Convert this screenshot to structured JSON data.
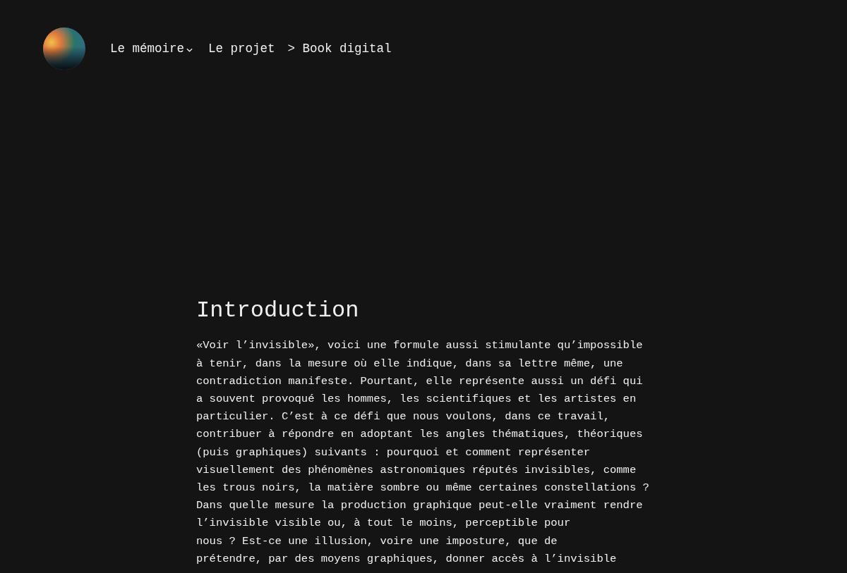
{
  "nav": {
    "items": [
      {
        "label": "Le mémoire",
        "kind": "dropdown"
      },
      {
        "label": "Le projet",
        "kind": "link"
      },
      {
        "label": "> Book digital",
        "kind": "link"
      }
    ]
  },
  "article": {
    "title": "Introduction",
    "paragraph": "«Voir l’invisible», voici une formule aussi stimulante qu’impossible\nà tenir, dans la mesure où elle indique, dans sa lettre même, une\ncontradiction manifeste. Pourtant, elle représente aussi un défi qui\na souvent provoqué les hommes, les scientifiques et les artistes en\nparticulier. C’est à ce défi que nous voulons, dans ce travail,\ncontribuer à répondre en adoptant les angles thématiques, théoriques\n(puis graphiques) suivants : pourquoi et comment représenter\nvisuellement des phénomènes astronomiques réputés invisibles, comme\nles trous noirs, la matière sombre ou même certaines constellations ?\nDans quelle mesure la production graphique peut-elle vraiment rendre\nl’invisible visible ou, à tout le moins, perceptible pour\nnous ? Est-ce une illusion, voire une imposture, que de\nprétendre, par des moyens graphiques, donner accès à l’invisible"
  }
}
